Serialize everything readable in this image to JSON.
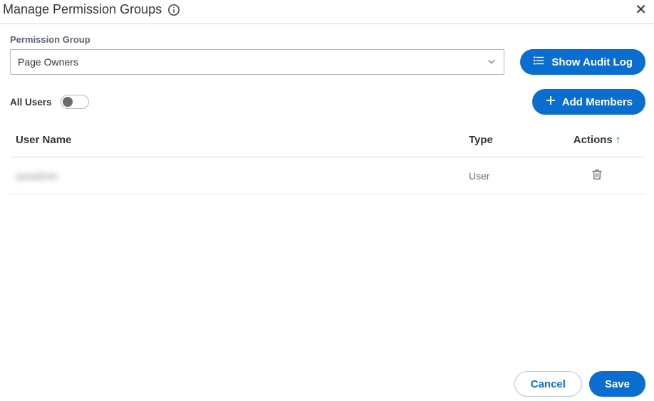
{
  "header": {
    "title": "Manage Permission Groups"
  },
  "form": {
    "permission_group_label": "Permission Group",
    "permission_group_value": "Page Owners",
    "show_audit_log_label": "Show Audit Log",
    "all_users_label": "All Users",
    "add_members_label": "Add Members"
  },
  "table": {
    "columns": {
      "user_name": "User Name",
      "type": "Type",
      "actions": "Actions"
    },
    "sort_indicator": "↑",
    "rows": [
      {
        "user_name": "sysadmin",
        "type": "User"
      }
    ]
  },
  "footer": {
    "cancel_label": "Cancel",
    "save_label": "Save"
  }
}
